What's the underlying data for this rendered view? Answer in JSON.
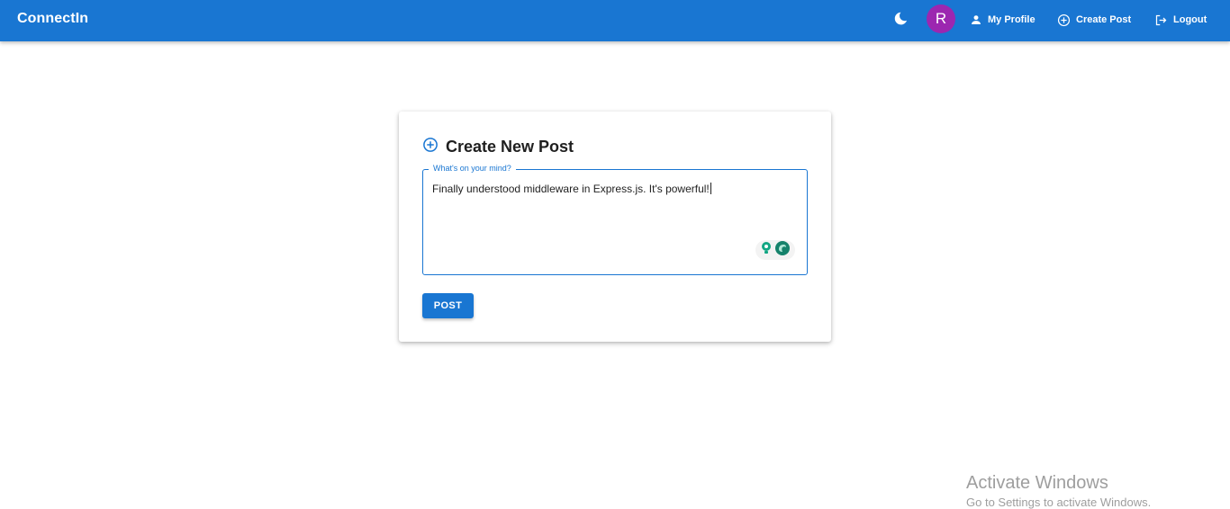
{
  "app": {
    "brand": "ConnectIn"
  },
  "header": {
    "theme_toggle_icon": "moon-icon",
    "avatar_initial": "R",
    "avatar_color": "#9c27b0",
    "nav": {
      "profile_label": "My Profile",
      "create_label": "Create Post",
      "logout_label": "Logout"
    },
    "bar_color": "#1976d2"
  },
  "card": {
    "title": "Create New Post",
    "field": {
      "label": "What's on your mind?",
      "value": "Finally understood middleware in Express.js. It's powerful!"
    },
    "post_button_label": "POST"
  },
  "watermark": {
    "title": "Activate Windows",
    "subtitle": "Go to Settings to activate Windows."
  }
}
